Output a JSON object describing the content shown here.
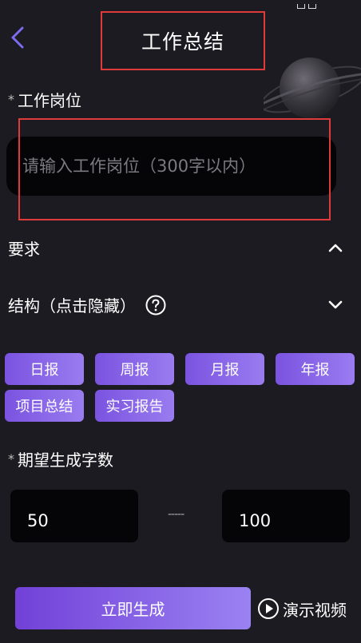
{
  "header": {
    "title": "工作总结",
    "back_icon": "chevron-left-icon",
    "accent": "#7b6cf0"
  },
  "job": {
    "label": "工作岗位",
    "required_mark": "*",
    "placeholder": "请输入工作岗位（300字以内）",
    "value": ""
  },
  "requirements": {
    "label": "要求",
    "expanded": true,
    "icon": "chevron-up-icon"
  },
  "structure": {
    "label": "结构（点击隐藏）",
    "help_icon": "question-circle-icon",
    "icon": "chevron-down-icon"
  },
  "tags": [
    "日报",
    "周报",
    "月报",
    "年报",
    "项目总结",
    "实习报告"
  ],
  "word_count": {
    "label": "期望生成字数",
    "required_mark": "*",
    "min": "50",
    "separator": "-----",
    "max": "100"
  },
  "actions": {
    "generate_label": "立即生成",
    "demo_label": "演示视频",
    "demo_icon": "play-circle-icon"
  },
  "colors": {
    "background": "#1c1b21",
    "input_bg": "#050507",
    "tag_gradient_start": "#7a53e0",
    "tag_gradient_end": "#9a7cf0",
    "highlight": "#e03b3b"
  }
}
